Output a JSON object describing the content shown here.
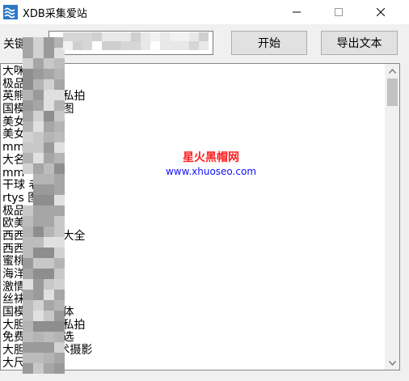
{
  "window": {
    "title": "XDB采集爱站"
  },
  "toolbar": {
    "keyword_label": "关键词",
    "keyword_value": "",
    "start_label": "开始",
    "export_label": "导出文本"
  },
  "watermark": {
    "title": "星火黑帽网",
    "url": "www.xhuoseo.com"
  },
  "results": [
    "大咪  宫",
    "极品  艺术",
    "英熊  胆宾馆私拍",
    "国模  门大开图",
    "美女",
    "美女",
    "mm",
    "大名",
    "mm",
    "干球  老阿姨",
    "rtys  图",
    "极品  术照",
    "欧美  术",
    "西西人  图片大全",
    "西西人",
    "蜜桃网",
    "海洋  裁",
    "激情  桃区",
    "丝袜美  截",
    "国模  私拍人体",
    "大胆国  人体私拍",
    "免费  私拍精选",
    "大胆  8体艺术摄影",
    "大尺度  通"
  ],
  "colors": {
    "window_bg": "#f0f0f0",
    "button_bg": "#e1e1e1",
    "watermark_title": "#ff2020",
    "watermark_url": "#1010ff",
    "app_icon": "#2c78c4"
  },
  "icons": {
    "app": "app-icon",
    "minimize": "minimize-icon",
    "maximize": "maximize-icon",
    "close": "close-icon",
    "scroll_up": "chevron-up-icon",
    "scroll_down": "chevron-down-icon"
  }
}
